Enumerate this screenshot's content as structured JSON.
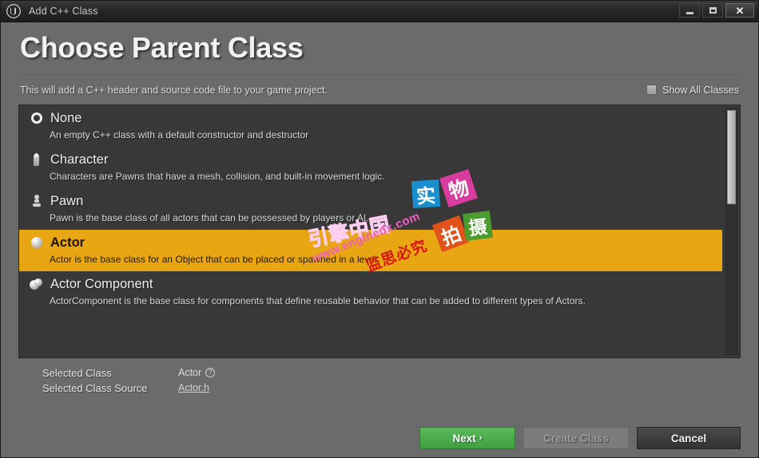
{
  "titlebar": {
    "title": "Add C++ Class",
    "logo_icon": "unreal-engine-logo-icon",
    "minimize_icon": "minimize-icon",
    "maximize_icon": "maximize-icon",
    "close_icon": "close-icon"
  },
  "header": {
    "page_title": "Choose Parent Class",
    "subtitle": "This will add a C++ header and source code file to your game project.",
    "show_all_classes_label": "Show All Classes",
    "show_all_classes_checked": false
  },
  "class_list": {
    "items": [
      {
        "name": "None",
        "description": "An empty C++ class with a default constructor and destructor",
        "icon": "ring-icon",
        "selected": false
      },
      {
        "name": "Character",
        "description": "Characters are Pawns that have a mesh, collision, and built-in movement logic.",
        "icon": "character-icon",
        "selected": false
      },
      {
        "name": "Pawn",
        "description": "Pawn is the base class of all actors that can be possessed by players or AI.",
        "icon": "pawn-icon",
        "selected": false
      },
      {
        "name": "Actor",
        "description": "Actor is the base class for an Object that can be placed or spawned in a level.",
        "icon": "sphere-icon",
        "selected": true
      },
      {
        "name": "Actor Component",
        "description": "ActorComponent is the base class for components that define reusable behavior that can be added to different types of Actors.",
        "icon": "component-icon",
        "selected": false
      }
    ],
    "selection_color": "#e8a612",
    "scrollbar": {
      "thumb_position": "top"
    }
  },
  "selected_info": {
    "class_label": "Selected Class",
    "class_value": "Actor",
    "class_help_icon": "help-icon",
    "source_label": "Selected Class Source",
    "source_value": "Actor.h"
  },
  "footer": {
    "next_label": "Next",
    "next_chevron": "›",
    "create_class_label": "Create Class",
    "create_class_disabled": true,
    "cancel_label": "Cancel",
    "next_color": "#4aa84a"
  },
  "watermarks": {
    "brand": "引擎中国",
    "url": "www.enginedx.com",
    "red_text": "监思必究",
    "squares": [
      {
        "char": "实",
        "color": "#1a8fd0"
      },
      {
        "char": "物",
        "color": "#d83c9e"
      },
      {
        "char": "拍",
        "color": "#e0541c"
      },
      {
        "char": "摄",
        "color": "#4b9b2e"
      }
    ]
  }
}
